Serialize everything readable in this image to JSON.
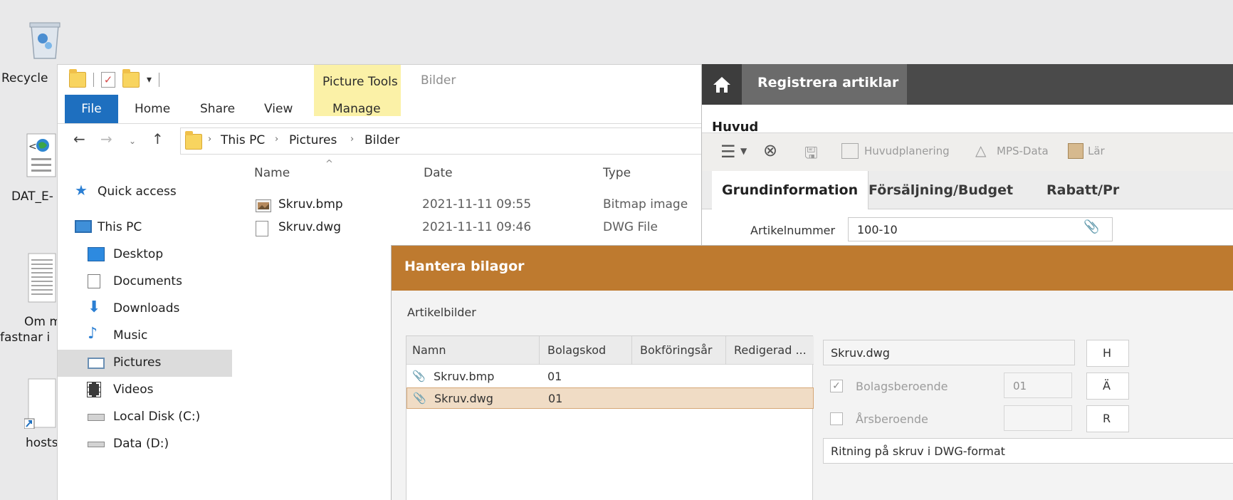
{
  "desktop": {
    "icons": [
      {
        "label": "Recycle",
        "icon": "recycle-bin-icon"
      },
      {
        "label": "DAT_E-",
        "icon": "web-document-icon"
      },
      {
        "label": "Om m",
        "label2": "fastnar i",
        "icon": "text-document-icon"
      },
      {
        "label": "hosts",
        "icon": "file-shortcut-icon"
      }
    ]
  },
  "explorer": {
    "qat_dropdown": "▾",
    "context_tab_label": "Picture Tools",
    "window_title": "Bilder",
    "tabs": {
      "file": "File",
      "home": "Home",
      "share": "Share",
      "view": "View",
      "manage": "Manage"
    },
    "breadcrumb": [
      "This PC",
      "Pictures",
      "Bilder"
    ],
    "columns": {
      "name": "Name",
      "date": "Date",
      "type": "Type"
    },
    "files": [
      {
        "name": "Skruv.bmp",
        "date": "2021-11-11 09:55",
        "type": "Bitmap image",
        "icon": "bitmap-file-icon"
      },
      {
        "name": "Skruv.dwg",
        "date": "2021-11-11 09:46",
        "type": "DWG File",
        "icon": "blank-file-icon"
      }
    ],
    "nav": {
      "quick_access": "Quick access",
      "this_pc": "This PC",
      "desktop": "Desktop",
      "documents": "Documents",
      "downloads": "Downloads",
      "music": "Music",
      "pictures": "Pictures",
      "videos": "Videos",
      "local_disk": "Local Disk (C:)",
      "data_d": "Data (D:)"
    },
    "selected_nav": "Pictures"
  },
  "erp": {
    "title": "Registrera artiklar",
    "main_tab": "Huvud",
    "toolbar": {
      "huvudplanering": "Huvudplanering",
      "mps": "MPS-Data",
      "lar": "Lär"
    },
    "tabs": [
      "Grundinformation",
      "Försäljning/Budget",
      "Rabatt/Pr"
    ],
    "field_label": "Artikelnummer",
    "field_value": "100-10"
  },
  "dialog": {
    "title": "Hantera bilagor",
    "section": "Artikelbilder",
    "columns": {
      "namn": "Namn",
      "bolagskod": "Bolagskod",
      "bokforingsar": "Bokföringsår",
      "redigerad": "Redigerad ..."
    },
    "rows": [
      {
        "name": "Skruv.bmp",
        "code": "01",
        "selected": false
      },
      {
        "name": "Skruv.dwg",
        "code": "01",
        "selected": true
      }
    ],
    "detail_name": "Skruv.dwg",
    "bolagsberoende_label": "Bolagsberoende",
    "bolagsberoende_checked": true,
    "bolagsberoende_value": "01",
    "arsberoende_label": "Årsberoende",
    "arsberoende_checked": false,
    "description": "Ritning på skruv i DWG-format",
    "side_buttons": [
      "H",
      "Ä",
      "R"
    ]
  },
  "colors": {
    "accent_orange": "#be7a2f",
    "file_tab_blue": "#1e6fbf",
    "picture_tools_yellow": "#fbf1a7"
  }
}
